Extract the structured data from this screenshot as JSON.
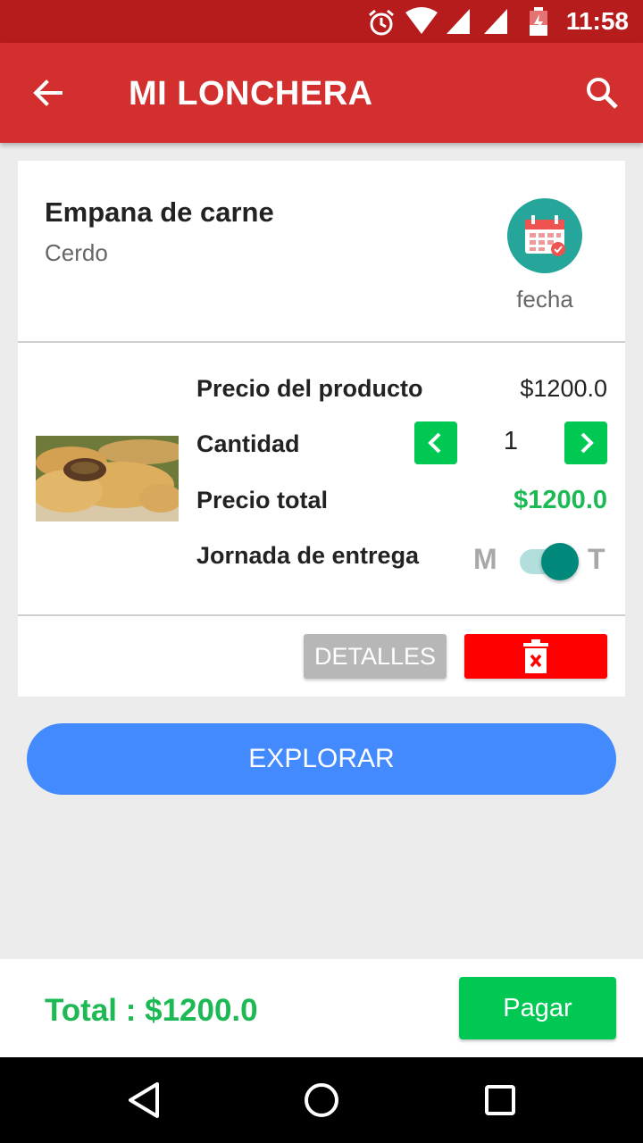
{
  "status_bar": {
    "time": "11:58"
  },
  "app_bar": {
    "title": "MI LONCHERA"
  },
  "item": {
    "name": "Empana de carne",
    "subtitle": "Cerdo",
    "date_label": "fecha",
    "price_label": "Precio del producto",
    "price_value": "$1200.0",
    "quantity_label": "Cantidad",
    "quantity_value": "1",
    "total_label": "Precio total",
    "total_value": "$1200.0",
    "shift_label": "Jornada de entrega",
    "shift_m": "M",
    "shift_t": "T",
    "details_button": "DETALLES"
  },
  "explore_button": "EXPLORAR",
  "footer": {
    "total": "Total : $1200.0",
    "pay_button": "Pagar"
  },
  "colors": {
    "primary": "#d32f2f",
    "primary_dark": "#b71c1c",
    "green": "#00c853",
    "price_green": "#1db954",
    "explore_blue": "#448aff",
    "delete_red": "#ff0000",
    "teal": "#26a69a"
  },
  "icons": [
    "alarm-icon",
    "wifi-icon",
    "signal-icon",
    "battery-icon",
    "back-arrow-icon",
    "search-icon",
    "calendar-icon",
    "chevron-left-icon",
    "chevron-right-icon",
    "delete-icon",
    "nav-back-icon",
    "nav-home-icon",
    "nav-recents-icon"
  ]
}
